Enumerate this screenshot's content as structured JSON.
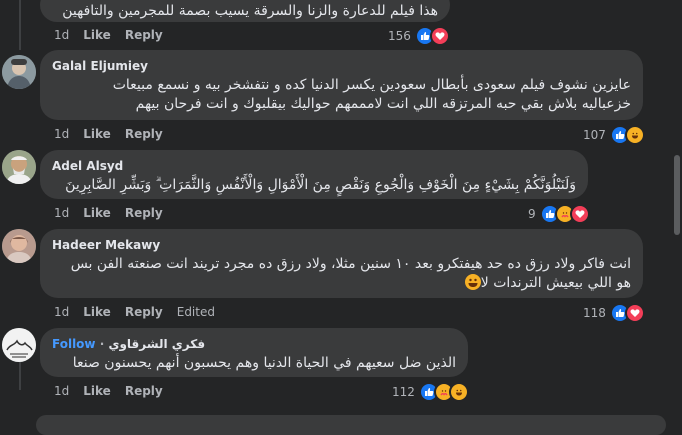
{
  "comments": [
    {
      "author": "",
      "text": "هذا فيلم للدعارة والزنا والسرقة يسيب بصمة للمجرمين والتافهين",
      "time": "1d",
      "like_label": "Like",
      "reply_label": "Reply",
      "reaction_count": "156",
      "reactions": [
        "like",
        "love"
      ]
    },
    {
      "author": "Galal Eljumiey",
      "text": "عايزين نشوف فيلم سعودى بأبطال سعودين يكسر الدنيا كده و نتفشخر بيه و نسمع مبيعات\nخزعباليه بلاش بقي حبه المرتزقه اللي انت لامممهم حواليك بيقلبوك و انت فرحان بيهم",
      "time": "1d",
      "like_label": "Like",
      "reply_label": "Reply",
      "reaction_count": "107",
      "reactions": [
        "like",
        "haha"
      ]
    },
    {
      "author": "Adel Alsyd",
      "text": "وَلَنَبْلُوَنَّكُمْ بِشَيْءٍ مِنَ الْخَوْفِ وَالْجُوعِ وَنَقْصٍ مِنَ الْأَمْوَالِ وَالْأَنْفُسِ وَالثَّمَرَاتِ ۗ وَبَشِّرِ الصَّابِرِينَ",
      "time": "1d",
      "like_label": "Like",
      "reply_label": "Reply",
      "reaction_count": "9",
      "reactions": [
        "like",
        "care",
        "love"
      ]
    },
    {
      "author": "Hadeer Mekawy",
      "text": "انت فاكر ولاد رزق ده حد هيفتكرو بعد ١٠ سنين مثلا، ولاد رزق ده مجرد تريند انت صنعته الفن بس\nهو اللي بيعيش الترندات لا",
      "time": "1d",
      "like_label": "Like",
      "reply_label": "Reply",
      "edited_label": "Edited",
      "reaction_count": "118",
      "reactions": [
        "like",
        "love"
      ]
    },
    {
      "author": "فكري الشرقاوي",
      "follow_label": "Follow",
      "text": "الذين ضل سعيهم في الحياة الدنيا وهم يحسبون أنهم يحسنون صنعا",
      "time": "1d",
      "like_label": "Like",
      "reply_label": "Reply",
      "reaction_count": "112",
      "reactions": [
        "like",
        "care",
        "haha"
      ]
    }
  ]
}
